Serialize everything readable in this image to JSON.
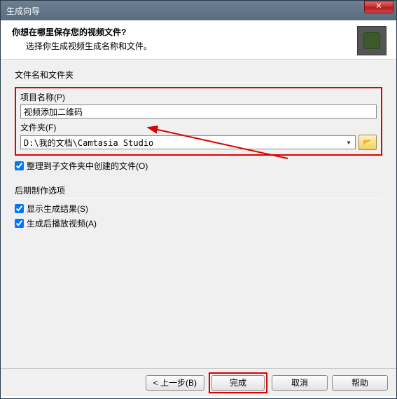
{
  "window": {
    "title": "生成向导"
  },
  "header": {
    "question": "你想在哪里保存您的视频文件?",
    "subtitle": "选择你生成视频生成名称和文件。"
  },
  "group1": {
    "title": "文件名和文件夹",
    "project_label": "项目名称(P)",
    "project_value": "视频添加二维码",
    "folder_label": "文件夹(F)",
    "folder_value": "D:\\我的文档\\Camtasia Studio",
    "organize_label": "整理到子文件夹中创建的文件(O)"
  },
  "group2": {
    "title": "后期制作选项",
    "show_results_label": "显示生成结果(S)",
    "play_after_label": "生成后播放视频(A)"
  },
  "footer": {
    "back": "< 上一步(B)",
    "finish": "完成",
    "cancel": "取消",
    "help": "帮助"
  },
  "icons": {
    "close": "✕",
    "browse": "📂",
    "dropdown": "▼"
  }
}
